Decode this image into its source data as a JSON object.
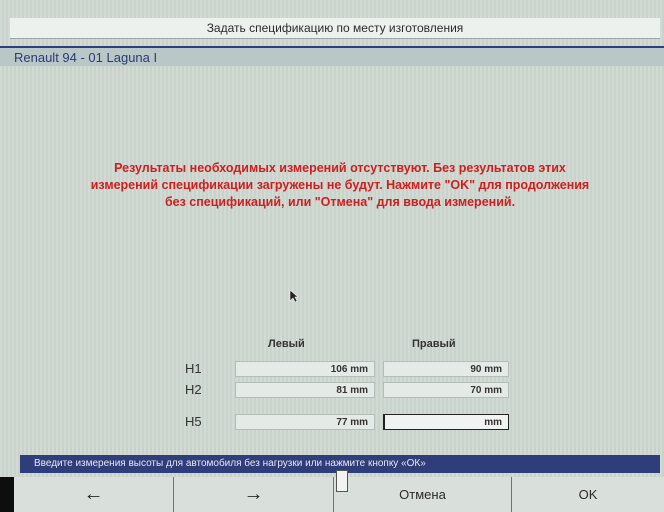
{
  "title": "Задать спецификацию по месту изготовления",
  "vehicle": "Renault 94 - 01 Laguna I",
  "message": "Результаты необходимых измерений отсутствуют. Без результатов этих измерений спецификации загружены не будут. Нажмите \"OK\" для продолжения без спецификаций, или \"Отмена\" для ввода измерений.",
  "table": {
    "col_left": "Левый",
    "col_right": "Правый",
    "rows": [
      {
        "label": "H1",
        "left": "106 mm",
        "right": "90 mm"
      },
      {
        "label": "H2",
        "left": "81 mm",
        "right": "70 mm"
      },
      {
        "label": "H5",
        "left": "77 mm",
        "right": "mm"
      }
    ]
  },
  "status": "Введите измерения высоты для автомобиля без нагрузки или нажмите кнопку «ОК»",
  "buttons": {
    "back_icon": "arrow-left-icon",
    "next_icon": "arrow-right-icon",
    "cancel": "Отмена",
    "ok": "OK"
  }
}
